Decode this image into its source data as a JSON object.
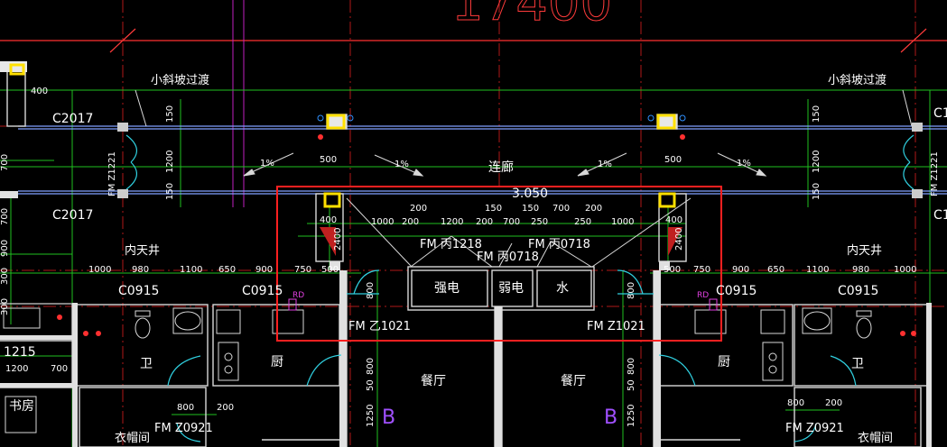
{
  "drawing": {
    "top_partial_dimension": "17400",
    "elevation": "3.050",
    "corridor": "连廊",
    "small_slope_left": "小斜坡过渡",
    "small_slope_right": "小斜坡过渡",
    "slope_1": "1%",
    "slope_2": "1%",
    "slope_3": "1%",
    "slope_4": "1%",
    "window_c2017_top": "C2017",
    "window_c2017_bottom": "C2017",
    "window_c1_top": "C1",
    "window_c1_bottom": "C1",
    "door_fm_z1221_left": "FM Z1221",
    "door_fm_z1221_right": "FM Z1221",
    "patio_left": "内天井",
    "patio_right": "内天井",
    "fm_bing_1218": "FM 丙1218",
    "fm_bing_0718_a": "FM 丙0718",
    "fm_bing_0718_b": "FM 丙0718",
    "room_strong": "强电",
    "room_weak": "弱电",
    "room_water": "水",
    "window_c0915_1": "C0915",
    "window_c0915_2": "C0915",
    "window_c0915_3": "C0915",
    "window_c0915_4": "C0915",
    "door_fm_yi1021": "FM 乙1021",
    "door_fm_z1021": "FM Z1021",
    "room_bath_left": "卫",
    "room_bath_right": "卫",
    "room_kitchen_left": "厨",
    "room_kitchen_right": "厨",
    "room_dining_left": "餐厅",
    "room_dining_right": "餐厅",
    "room_cloak_left": "衣帽间",
    "room_cloak_right": "衣帽间",
    "door_fm_z0921_left": "FM Z0921",
    "door_fm_z0921_right": "FM Z0921",
    "room_study": "书房",
    "code_1215": "1215",
    "unit_b_left": "B",
    "unit_b_right": "B",
    "rd_left": "RD",
    "rd_right": "RD",
    "dims_corridor_left": [
      "150",
      "1200",
      "150"
    ],
    "dims_corridor_right": [
      "150",
      "1200",
      "150"
    ],
    "dims_top_500": [
      "500",
      "500"
    ],
    "dims_row_core": [
      "200",
      "150",
      "150",
      "700",
      "200"
    ],
    "dims_row_core2": [
      "400",
      "1000",
      "200",
      "1200",
      "200",
      "700",
      "250",
      "250",
      "1000",
      "400"
    ],
    "dims_row_left": [
      "1000",
      "980",
      "1100",
      "650",
      "900",
      "750",
      "500"
    ],
    "dims_row_right": [
      "500",
      "750",
      "900",
      "650",
      "1100",
      "980",
      "1000"
    ],
    "dims_vertical_left": [
      "2400",
      "800",
      "800",
      "50",
      "1250"
    ],
    "dims_vertical_right": [
      "2400",
      "800",
      "800",
      "50",
      "1250"
    ],
    "dims_left_edge": [
      "400",
      "700",
      "900",
      "300",
      "300",
      "700",
      "1200",
      "700"
    ],
    "dims_bottom_left": [
      "800",
      "200"
    ],
    "dims_bottom_right": [
      "800",
      "200"
    ]
  }
}
